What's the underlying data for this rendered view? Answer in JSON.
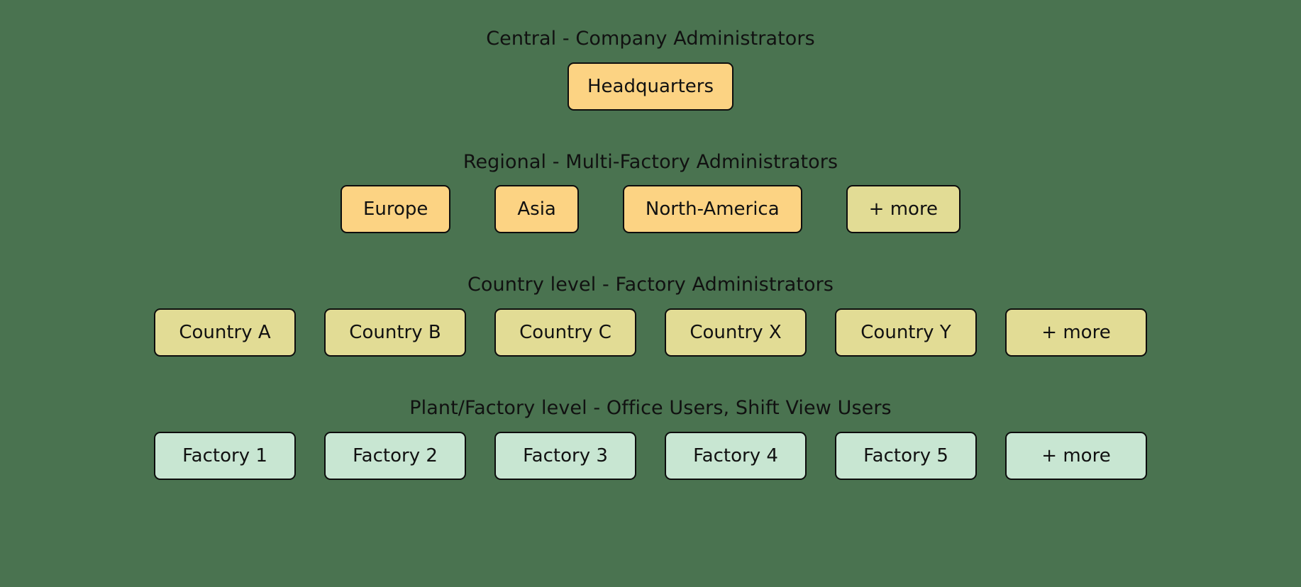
{
  "background_color": "#4a7350",
  "colors": {
    "central_fill": "#fcd383",
    "regional_fill": "#fcd383",
    "regional_more_fill": "#e2dc95",
    "country_fill": "#e2dc95",
    "factory_fill": "#c8e6d2",
    "border": "#0d0d0d",
    "text": "#111111"
  },
  "tiers": [
    {
      "id": "central",
      "title": "Central - Company Administrators",
      "nodes": [
        {
          "label": "Headquarters",
          "variant": "primary"
        }
      ]
    },
    {
      "id": "regional",
      "title": "Regional - Multi-Factory Administrators",
      "nodes": [
        {
          "label": "Europe",
          "variant": "primary"
        },
        {
          "label": "Asia",
          "variant": "primary"
        },
        {
          "label": "North-America",
          "variant": "primary"
        },
        {
          "label": "+ more",
          "variant": "muted"
        }
      ]
    },
    {
      "id": "country",
      "title": "Country level - Factory Administrators",
      "nodes": [
        {
          "label": "Country A",
          "variant": "primary"
        },
        {
          "label": "Country B",
          "variant": "primary"
        },
        {
          "label": "Country C",
          "variant": "primary"
        },
        {
          "label": "Country X",
          "variant": "primary"
        },
        {
          "label": "Country Y",
          "variant": "primary"
        },
        {
          "label": "+ more",
          "variant": "primary"
        }
      ]
    },
    {
      "id": "plant",
      "title": "Plant/Factory level - Office Users, Shift View Users",
      "nodes": [
        {
          "label": "Factory 1",
          "variant": "primary"
        },
        {
          "label": "Factory 2",
          "variant": "primary"
        },
        {
          "label": "Factory 3",
          "variant": "primary"
        },
        {
          "label": "Factory 4",
          "variant": "primary"
        },
        {
          "label": "Factory 5",
          "variant": "primary"
        },
        {
          "label": "+ more",
          "variant": "primary"
        }
      ]
    }
  ]
}
